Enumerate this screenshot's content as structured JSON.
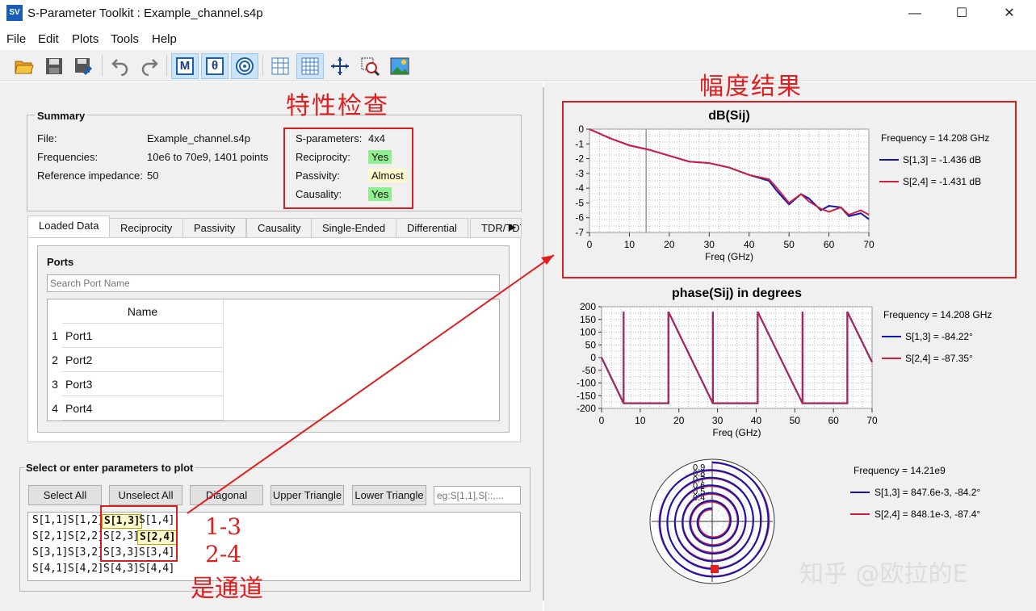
{
  "window": {
    "title": "S-Parameter Toolkit : Example_channel.s4p",
    "logo": "SV",
    "minimize": "—",
    "maximize": "☐",
    "close": "✕"
  },
  "menu": [
    "File",
    "Edit",
    "Plots",
    "Tools",
    "Help"
  ],
  "toolbar": {
    "m_label": "M",
    "theta_label": "θ"
  },
  "summary": {
    "title": "Summary",
    "file_label": "File:",
    "file_value": "Example_channel.s4p",
    "freq_label": "Frequencies:",
    "freq_value": "10e6 to 70e9, 1401 points",
    "ref_label": "Reference impedance:",
    "ref_value": "50",
    "sparams_label": "S-parameters:",
    "sparams_value": "4x4",
    "recip_label": "Reciprocity:",
    "recip_value": "Yes",
    "pass_label": "Passivity:",
    "pass_value": "Almost",
    "caus_label": "Causality:",
    "caus_value": "Yes"
  },
  "tabs": [
    "Loaded Data",
    "Reciprocity",
    "Passivity",
    "Causality",
    "Single-Ended",
    "Differential",
    "TDR/TDT"
  ],
  "ports": {
    "title": "Ports",
    "search_placeholder": "Search Port Name",
    "column": "Name",
    "rows": [
      {
        "num": "1",
        "name": "Port1"
      },
      {
        "num": "2",
        "name": "Port2"
      },
      {
        "num": "3",
        "name": "Port3"
      },
      {
        "num": "4",
        "name": "Port4"
      }
    ]
  },
  "select": {
    "title": "Select or enter parameters to plot",
    "buttons": [
      "Select All",
      "Unselect All",
      "Diagonal",
      "Upper Triangle",
      "Lower Triangle"
    ],
    "entry_placeholder": "eg:S[1,1],S[::,...",
    "grid": [
      [
        "S[1,1]",
        "S[1,2]",
        "S[1,3]",
        "S[1,4]"
      ],
      [
        "S[2,1]",
        "S[2,2]",
        "S[2,3]",
        "S[2,4]"
      ],
      [
        "S[3,1]",
        "S[3,2]",
        "S[3,3]",
        "S[3,4]"
      ],
      [
        "S[4,1]",
        "S[4,2]",
        "S[4,3]",
        "S[4,4]"
      ]
    ]
  },
  "annotations": {
    "check": "特性检查",
    "magnitude": "幅度结果",
    "channel_1": "1-3",
    "channel_2": "2-4",
    "channel_3": "是通道",
    "watermark": "知乎 @欧拉的E"
  },
  "colors": {
    "s13": "#1515b0",
    "s24": "#cc2040",
    "annotation": "#e02020"
  },
  "chart_data": [
    {
      "type": "line",
      "title": "dB(Sij)",
      "xlabel": "Freq (GHz)",
      "ylabel": "",
      "xlim": [
        0,
        70
      ],
      "ylim": [
        -7,
        0
      ],
      "x_ticks": [
        "0",
        "10",
        "20",
        "30",
        "40",
        "50",
        "60",
        "70"
      ],
      "y_ticks": [
        "0",
        "-1",
        "-2",
        "-3",
        "-4",
        "-5",
        "-6",
        "-7"
      ],
      "grid": true,
      "legend_title": "Frequency = 14.208 GHz",
      "series": [
        {
          "name": "S[1,3] = -1.436 dB",
          "x": [
            0,
            5,
            10,
            15,
            20,
            25,
            30,
            35,
            40,
            45,
            47,
            50,
            53,
            55,
            58,
            60,
            63,
            65,
            68,
            70
          ],
          "values": [
            0,
            -0.6,
            -1.1,
            -1.4,
            -1.8,
            -2.2,
            -2.3,
            -2.6,
            -3.1,
            -3.5,
            -4.2,
            -5.1,
            -4.4,
            -4.7,
            -5.5,
            -5.2,
            -5.3,
            -5.9,
            -5.7,
            -6.1
          ]
        },
        {
          "name": "S[2,4] = -1.431 dB",
          "x": [
            0,
            5,
            10,
            15,
            20,
            25,
            30,
            35,
            40,
            45,
            47,
            50,
            53,
            55,
            58,
            60,
            63,
            65,
            68,
            70
          ],
          "values": [
            0,
            -0.6,
            -1.1,
            -1.4,
            -1.8,
            -2.2,
            -2.3,
            -2.6,
            -3.1,
            -3.4,
            -4.0,
            -5.0,
            -4.4,
            -4.9,
            -5.4,
            -5.6,
            -5.3,
            -5.8,
            -5.5,
            -5.8
          ]
        }
      ]
    },
    {
      "type": "line",
      "title": "phase(Sij) in degrees",
      "xlabel": "Freq (GHz)",
      "ylabel": "",
      "xlim": [
        0,
        70
      ],
      "ylim": [
        -200,
        200
      ],
      "x_ticks": [
        "0",
        "10",
        "20",
        "30",
        "40",
        "50",
        "60",
        "70"
      ],
      "y_ticks": [
        "200",
        "150",
        "100",
        "50",
        "0",
        "-50",
        "-100",
        "-150",
        "-200"
      ],
      "grid": true,
      "legend_title": "Frequency = 14.208 GHz",
      "series": [
        {
          "name": "S[1,3] = -84.22°",
          "wrap_freqs_ghz": [
            0,
            5.7,
            17.3,
            28.8,
            40.4,
            52.0,
            63.6
          ],
          "values": [
            0,
            -180,
            180,
            -180,
            180,
            -180,
            180
          ]
        },
        {
          "name": "S[2,4] = -87.35°",
          "wrap_freqs_ghz": [
            0,
            5.7,
            17.3,
            28.8,
            40.4,
            52.0,
            63.6
          ],
          "values": [
            0,
            -180,
            180,
            -180,
            180,
            -180,
            180
          ]
        }
      ]
    },
    {
      "type": "scatter",
      "title": "",
      "xlabel": "",
      "ylabel": "",
      "subtype": "polar",
      "radial_ticks": [
        "0.9",
        "0.8",
        "0.7",
        "0.6",
        "0.5",
        "0.4"
      ],
      "legend_title": "Frequency = 14.21e9",
      "series": [
        {
          "name": "S[1,3] = 847.6e-3, -84.2°"
        },
        {
          "name": "S[2,4] = 848.1e-3, -87.4°"
        }
      ]
    }
  ]
}
